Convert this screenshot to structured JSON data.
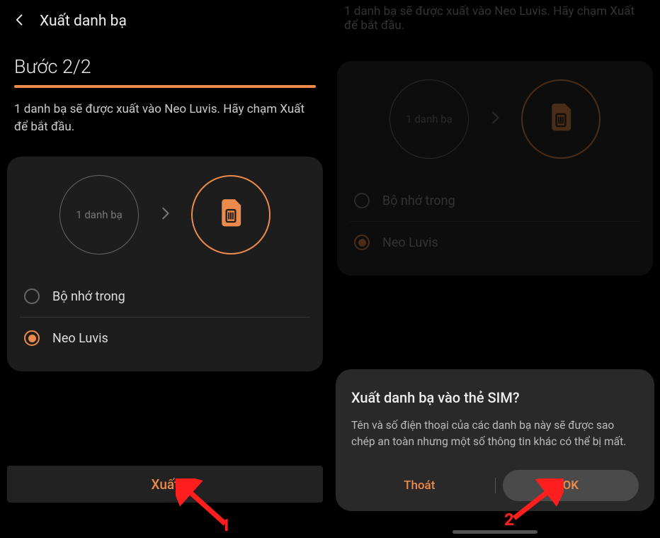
{
  "left": {
    "header_title": "Xuất danh bạ",
    "step_label": "Bước 2/2",
    "description": "1 danh bạ sẽ được xuất vào Neo Luvis. Hãy chạm Xuất để bắt đầu.",
    "source_circle_label": "1 danh bạ",
    "options": {
      "internal": "Bộ nhớ trong",
      "neoluvis": "Neo Luvis"
    },
    "export_button": "Xuất"
  },
  "right": {
    "hidden_description": "1 danh bạ sẽ được xuất vào Neo Luvis. Hãy chạm Xuất để bắt đầu.",
    "source_circle_label": "1 danh bạ",
    "options": {
      "internal": "Bộ nhớ trong",
      "neoluvis": "Neo Luvis"
    },
    "dialog": {
      "title": "Xuất danh bạ vào thẻ SIM?",
      "body": "Tên và số điện thoại của các danh bạ này sẽ được sao chép an toàn nhưng một số thông tin khác có thể bị mất.",
      "cancel": "Thoát",
      "ok": "OK"
    }
  },
  "annotations": {
    "num1": "1",
    "num2": "2"
  },
  "colors": {
    "accent": "#eb8a4a",
    "annotation": "#ff1e1e"
  }
}
